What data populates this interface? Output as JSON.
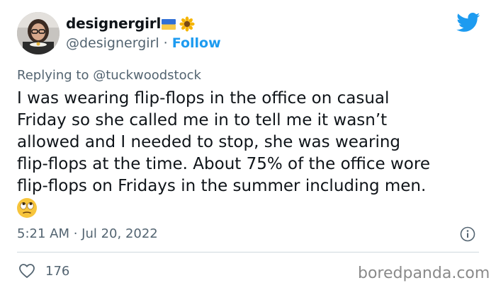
{
  "user": {
    "display_name": "designergirl",
    "handle": "@designergirl",
    "separator": " · ",
    "follow_label": "Follow"
  },
  "reply": {
    "prefix": "Replying to ",
    "mention": "@tuckwoodstock"
  },
  "tweet": {
    "text": "I was wearing flip-flops in the office on casual\nFriday so she called me in to tell me it wasn’t\nallowed and I needed to stop, she was wearing\nflip-flops at the time. About 75% of the office wore\nflip-flops on Fridays in the summer including men."
  },
  "meta": {
    "timestamp": "5:21 AM · Jul 20, 2022"
  },
  "actions": {
    "likes": "176"
  },
  "watermark": "boredpanda.com",
  "colors": {
    "link": "#1d9bf0",
    "secondary_text": "#536471",
    "divider": "#cfd9de"
  },
  "icons": [
    "ukraine-flag-icon",
    "sunflower-icon",
    "twitter-bird-icon",
    "face-with-rolling-eyes-icon",
    "info-icon",
    "heart-icon"
  ]
}
